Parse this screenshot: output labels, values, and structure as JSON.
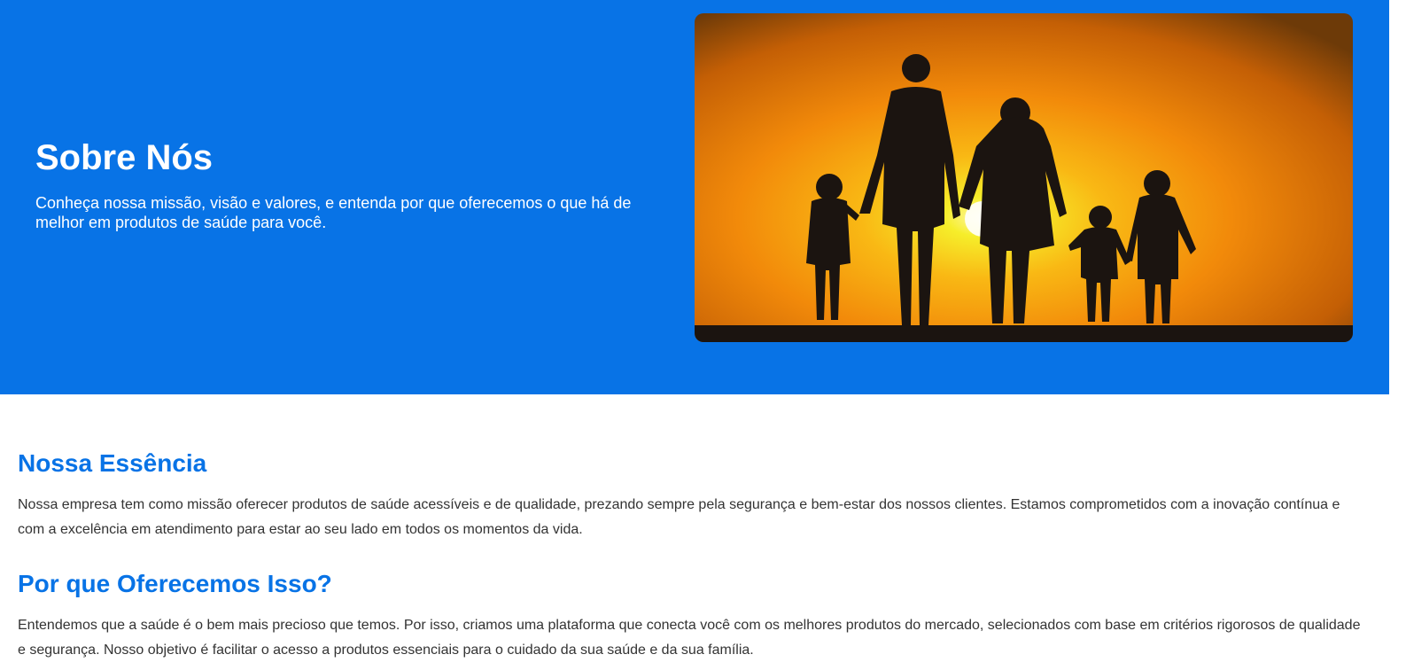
{
  "hero": {
    "title": "Sobre Nós",
    "subtitle": "Conheça nossa missão, visão e valores, e entenda por que oferecemos o que há de melhor em produtos de saúde para você.",
    "image_icon": "family-sunset-photo",
    "background_color": "#0873e6"
  },
  "sections": [
    {
      "title": "Nossa Essência",
      "text": "Nossa empresa tem como missão oferecer produtos de saúde acessíveis e de qualidade, prezando sempre pela segurança e bem-estar dos nossos clientes. Estamos comprometidos com a inovação contínua e com a excelência em atendimento para estar ao seu lado em todos os momentos da vida."
    },
    {
      "title": "Por que Oferecemos Isso?",
      "text": "Entendemos que a saúde é o bem mais precioso que temos. Por isso, criamos uma plataforma que conecta você com os melhores produtos do mercado, selecionados com base em critérios rigorosos de qualidade e segurança. Nosso objetivo é facilitar o acesso a produtos essenciais para o cuidado da sua saúde e da sua família."
    }
  ],
  "colors": {
    "accent": "#0873e6",
    "body_text": "#333333"
  }
}
